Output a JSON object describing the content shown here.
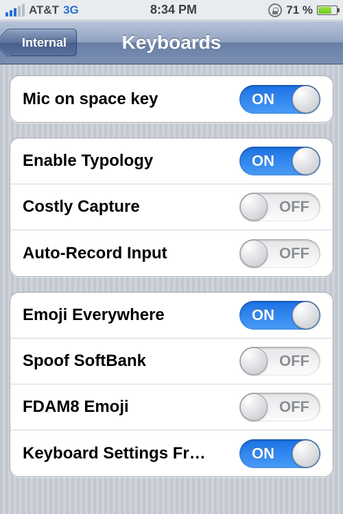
{
  "status": {
    "carrier": "AT&T",
    "network": "3G",
    "time": "8:34 PM",
    "battery_pct": "71 %"
  },
  "nav": {
    "back_label": "Internal",
    "title": "Keyboards"
  },
  "toggle_labels": {
    "on": "ON",
    "off": "OFF"
  },
  "groups": [
    {
      "rows": [
        {
          "label": "Mic on space key",
          "on": true
        }
      ]
    },
    {
      "rows": [
        {
          "label": "Enable Typology",
          "on": true
        },
        {
          "label": "Costly Capture",
          "on": false
        },
        {
          "label": "Auto-Record Input",
          "on": false
        }
      ]
    },
    {
      "rows": [
        {
          "label": "Emoji Everywhere",
          "on": true
        },
        {
          "label": "Spoof SoftBank",
          "on": false
        },
        {
          "label": "FDAM8 Emoji",
          "on": false
        },
        {
          "label": "Keyboard Settings Fr…",
          "on": true
        }
      ]
    }
  ]
}
